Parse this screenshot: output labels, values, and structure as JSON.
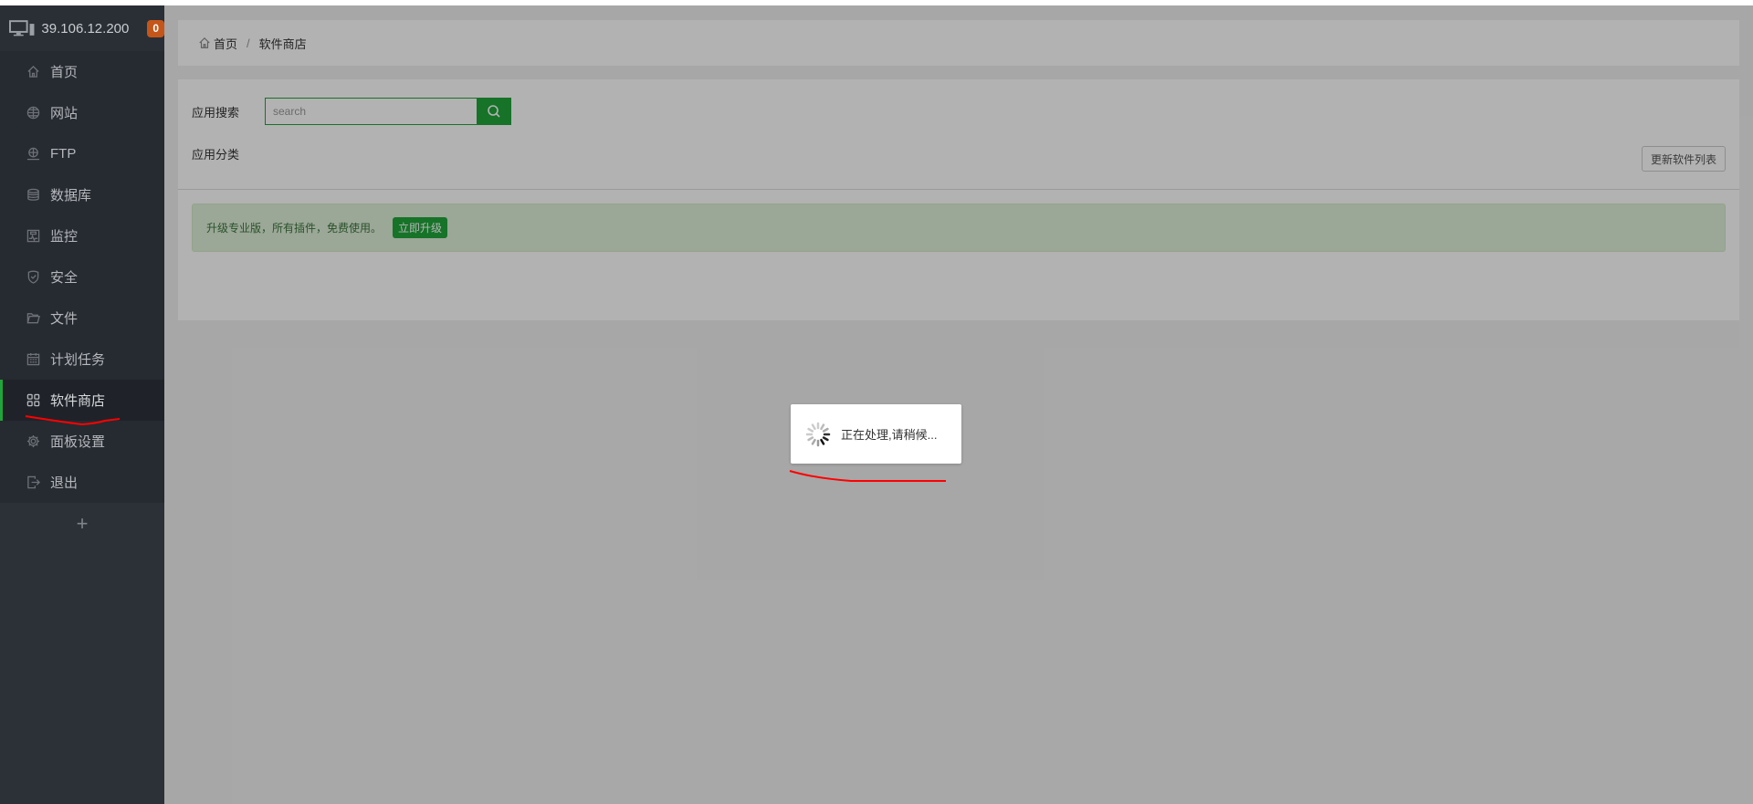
{
  "sidebar": {
    "host": "39.106.12.200",
    "badge_count": "0",
    "items": [
      {
        "label": "首页",
        "icon": "home-icon"
      },
      {
        "label": "网站",
        "icon": "globe-icon"
      },
      {
        "label": "FTP",
        "icon": "ftp-icon"
      },
      {
        "label": "数据库",
        "icon": "database-icon"
      },
      {
        "label": "监控",
        "icon": "monitor-chart-icon"
      },
      {
        "label": "安全",
        "icon": "shield-icon"
      },
      {
        "label": "文件",
        "icon": "folder-icon"
      },
      {
        "label": "计划任务",
        "icon": "calendar-icon"
      },
      {
        "label": "软件商店",
        "icon": "grid-icon",
        "active": true
      },
      {
        "label": "面板设置",
        "icon": "gear-icon"
      },
      {
        "label": "退出",
        "icon": "logout-icon"
      }
    ],
    "add_label": "+"
  },
  "breadcrumb": {
    "home": "首页",
    "separator": "/",
    "current": "软件商店"
  },
  "store": {
    "search_label": "应用搜索",
    "search_placeholder": "search",
    "search_value": "",
    "category_label": "应用分类",
    "update_button": "更新软件列表",
    "alert_text": "升级专业版，所有插件，免费使用。",
    "upgrade_button": "立即升级"
  },
  "loading": {
    "text": "正在处理,请稍候..."
  },
  "colors": {
    "accent": "#20a53a",
    "badge": "#c4561a",
    "sidebar_bg": "#2c3138",
    "annotation": "#ff0000"
  }
}
